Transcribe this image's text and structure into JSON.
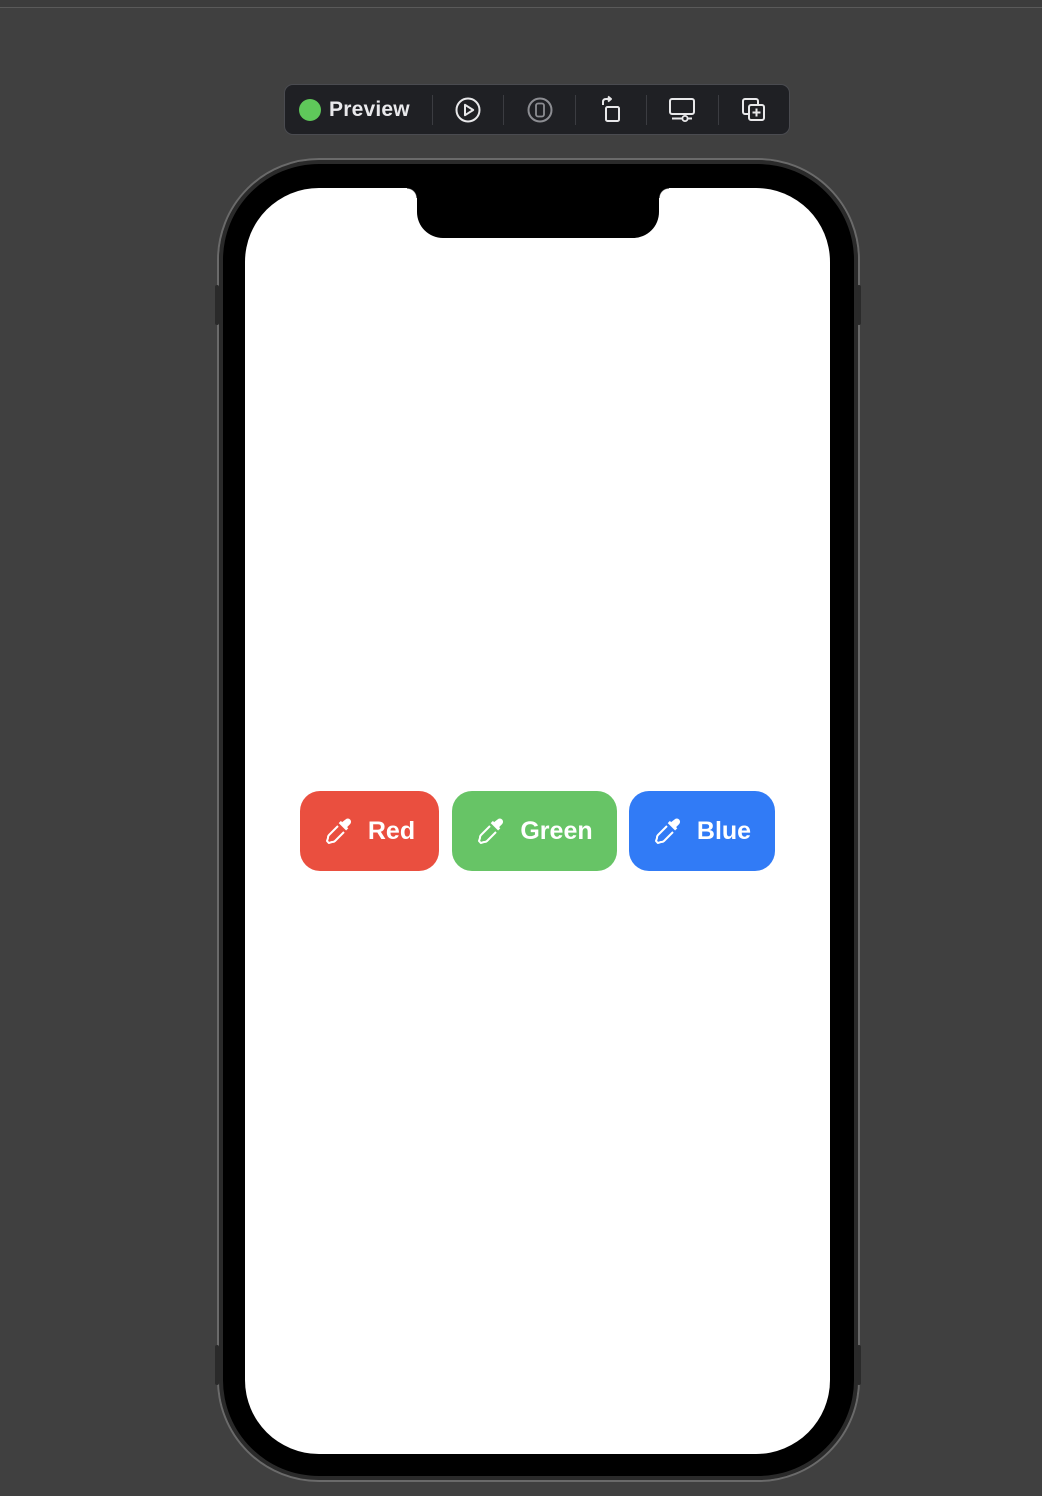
{
  "toolbar": {
    "status_label": "Preview",
    "status_color": "#5fc85a",
    "buttons": [
      {
        "name": "live-preview",
        "icon": "play-circle-icon"
      },
      {
        "name": "device-settings",
        "icon": "device-icon"
      },
      {
        "name": "rotate",
        "icon": "rotate-icon"
      },
      {
        "name": "variants",
        "icon": "display-settings-icon"
      },
      {
        "name": "duplicate",
        "icon": "duplicate-plus-icon"
      }
    ]
  },
  "screen": {
    "buttons": [
      {
        "label": "Red",
        "color": "#ea4f3f",
        "icon": "eyedropper-icon"
      },
      {
        "label": "Green",
        "color": "#67c466",
        "icon": "eyedropper-icon"
      },
      {
        "label": "Blue",
        "color": "#317bf6",
        "icon": "eyedropper-icon"
      }
    ]
  }
}
